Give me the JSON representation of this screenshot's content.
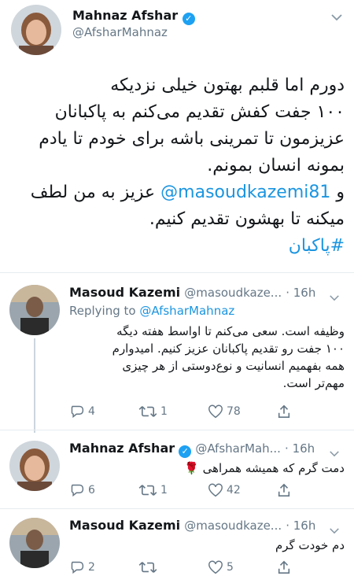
{
  "main_tweet": {
    "name": "Mahnaz Afshar",
    "handle": "@AfsharMahnaz",
    "lines": [
      "دورم اما قلبم بهتون خیلی نزدیکه",
      "۱۰۰ جفت کفش تقدیم می‌کنم به پاکبانان",
      "عزیزمون تا تمرینی باشه برای خودم تا یادم",
      "بمونه انسان بمونم."
    ],
    "mention_line_pre": "و",
    "mention": "@masoudkazemi81",
    "mention_line_post": "عزیز به من لطف",
    "line6": "میکنه تا بهشون تقدیم کنیم.",
    "hashtag": "#پاکبان"
  },
  "replies": [
    {
      "name": "Masoud Kazemi",
      "handle": "@masoudkaze...",
      "time": "· 16h",
      "replying_to_label": "Replying to",
      "replying_to_handle": "@AfsharMahnaz",
      "lines": [
        "وظیفه است. سعی می‌کنم تا اواسط هفته دیگه",
        "۱۰۰ جفت رو تقدیم پاکبانان عزیز کنیم. امیدوارم",
        "همه بفهمیم انسانیت و نوع‌دوستی از هر چیزی",
        "مهم‌تر است."
      ],
      "reply_count": "4",
      "retweet_count": "1",
      "like_count": "78"
    },
    {
      "name": "Mahnaz Afshar",
      "handle": "@AfsharMah...",
      "time": "· 16h",
      "lines": [
        "دمت گرم که همیشه همراهی 🌹"
      ],
      "reply_count": "6",
      "retweet_count": "1",
      "like_count": "42"
    },
    {
      "name": "Masoud Kazemi",
      "handle": "@masoudkaze...",
      "time": "· 16h",
      "lines": [
        "دم خودت گرم"
      ],
      "reply_count": "2",
      "retweet_count": "",
      "like_count": "5"
    }
  ],
  "icons": [
    "verified-badge-icon",
    "chevron-down-icon",
    "reply-icon",
    "retweet-icon",
    "like-icon",
    "share-icon"
  ],
  "colors": {
    "link": "#1b95e0",
    "verified": "#1da1f2",
    "muted": "#657786"
  }
}
